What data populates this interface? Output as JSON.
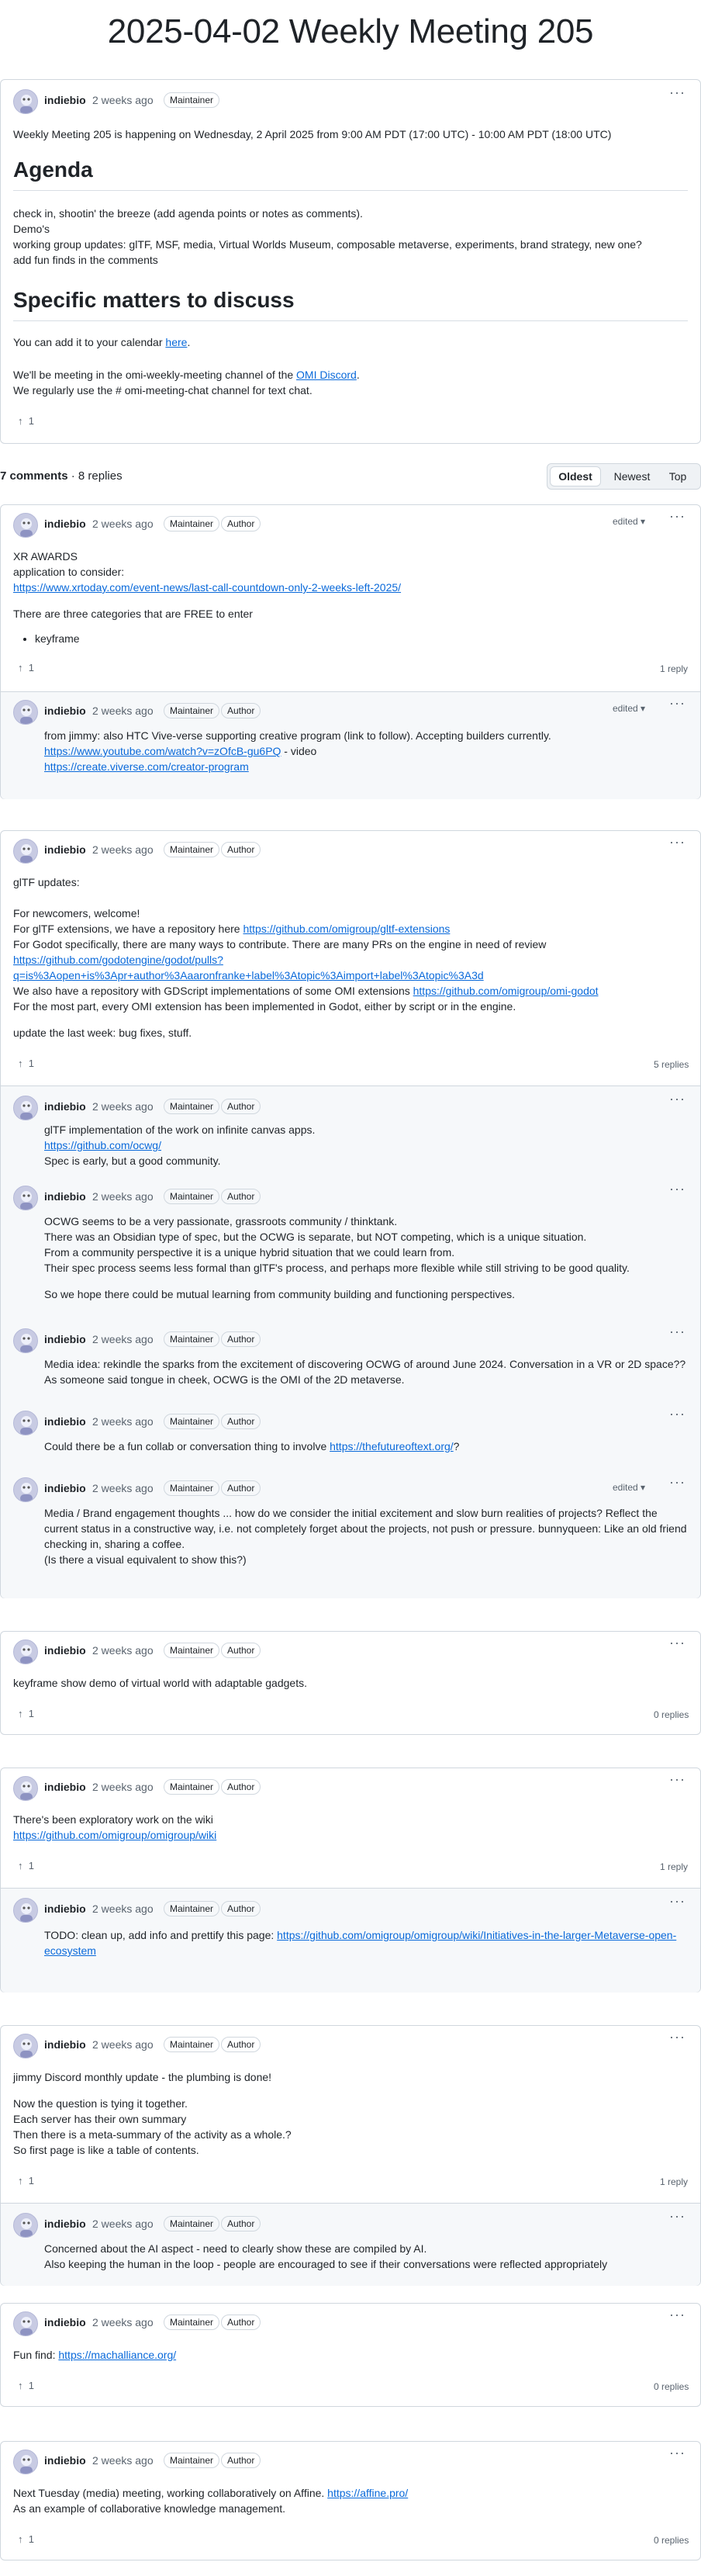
{
  "page_title": "2025-04-02 Weekly Meeting 205",
  "post": {
    "author": "indiebio",
    "time": "2 weeks ago",
    "badge": "Maintainer",
    "intro": "Weekly Meeting 205 is happening on Wednesday, 2 April 2025 from 9:00 AM PDT (17:00 UTC) - 10:00 AM PDT (18:00 UTC)",
    "agenda_heading": "Agenda",
    "agenda_lines": [
      "check in, shootin' the breeze (add agenda points or notes as comments).",
      "Demo's",
      "working group updates: glTF, MSF, media, Virtual Worlds Museum, composable metaverse, experiments, brand strategy, new one?",
      "add fun finds in the comments"
    ],
    "matters_heading": "Specific matters to discuss",
    "calendar_pre": "You can add it to your calendar ",
    "calendar_link": "here",
    "calendar_post": ".",
    "discord_pre": "We'll be meeting in the omi-weekly-meeting channel of the ",
    "discord_link": "OMI Discord",
    "discord_post": ".",
    "chat_line": "We regularly use the # omi-meeting-chat channel for text chat.",
    "upvotes": "1"
  },
  "comments_header": {
    "count": "7 comments",
    "sep": " · ",
    "replies": "8 replies"
  },
  "sort": {
    "oldest": "Oldest",
    "newest": "Newest",
    "top": "Top"
  },
  "labels": {
    "maintainer": "Maintainer",
    "author": "Author",
    "edited": "edited",
    "author_name": "indiebio",
    "time": "2 weeks ago"
  },
  "c1": {
    "l1": "XR AWARDS",
    "l2": "application to consider:",
    "link": "https://www.xrtoday.com/event-news/last-call-countdown-only-2-weeks-left-2025/",
    "l3": "There are three categories that are FREE to enter",
    "bullet": "keyframe",
    "upvotes": "1",
    "replies": "1 reply",
    "r1": {
      "l1": "from jimmy: also HTC Vive-verse supporting creative program (link to follow). Accepting builders currently.",
      "link1": "https://www.youtube.com/watch?v=zOfcB-gu6PQ",
      "l2": " - video",
      "link2": "https://create.viverse.com/creator-program"
    }
  },
  "c2": {
    "l1": "glTF updates:",
    "l2": "For newcomers, welcome!",
    "l3": "For glTF extensions, we have a repository here ",
    "link1": "https://github.com/omigroup/gltf-extensions",
    "l4": "For Godot specifically, there are many ways to contribute. There are many PRs on the engine in need of review",
    "link2a": "https://github.com/godotengine/godot/pulls?",
    "link2b": "q=is%3Aopen+is%3Apr+author%3Aaaronfranke+label%3Atopic%3Aimport+label%3Atopic%3A3d",
    "l5": "We also have a repository with GDScript implementations of some OMI extensions ",
    "link3": "https://github.com/omigroup/omi-godot",
    "l6": "For the most part, every OMI extension has been implemented in Godot, either by script or in the engine.",
    "l7": "update the last week: bug fixes, stuff.",
    "upvotes": "1",
    "replies": "5 replies",
    "r1": {
      "l1": "glTF implementation of the work on infinite canvas apps.",
      "link": "https://github.com/ocwg/",
      "l2": "Spec is early, but a good community."
    },
    "r2": {
      "l1": "OCWG seems to be a very passionate, grassroots community / thinktank.",
      "l2": "There was an Obsidian type of spec, but the OCWG is separate, but NOT competing, which is a unique situation.",
      "l3": "From a community perspective it is a unique hybrid situation that we could learn from.",
      "l4": "Their spec process seems less formal than glTF's process, and perhaps more flexible while still striving to be good quality.",
      "l5": "So we hope there could be mutual learning from community building and functioning perspectives."
    },
    "r3": {
      "l1": "Media idea: rekindle the sparks from the excitement of discovering OCWG of around June 2024. Conversation in a VR or 2D space??",
      "l2": "As someone said tongue in cheek, OCWG is the OMI of the 2D metaverse."
    },
    "r4": {
      "l1": "Could there be a fun collab or conversation thing to involve ",
      "link": "https://thefutureoftext.org/",
      "l2": "?"
    },
    "r5": {
      "l1": "Media / Brand engagement thoughts ... how do we consider the initial excitement and slow burn realities of projects? Reflect the",
      "l2": "current status in a constructive way, i.e. not completely forget about the projects, not push or pressure. bunnyqueen: Like an old friend",
      "l3": "checking in, sharing a coffee.",
      "l4": "(Is there a visual equivalent to show this?)"
    }
  },
  "c3": {
    "l1": "keyframe show demo of virtual world with adaptable gadgets.",
    "upvotes": "1",
    "replies": "0 replies"
  },
  "c4": {
    "l1": "There's been exploratory work on the wiki",
    "link": "https://github.com/omigroup/omigroup/wiki",
    "upvotes": "1",
    "replies": "1 reply",
    "r1": {
      "l1": "TODO: clean up, add info and prettify this page: ",
      "link_a": "https://github.com/omigroup/omigroup/wiki/Initiatives-in-the-larger-Metaverse-open-",
      "link_b": "ecosystem"
    }
  },
  "c5": {
    "l1": "jimmy Discord monthly update - the plumbing is done!",
    "l2": "Now the question is tying it together.",
    "l3": "Each server has their own summary",
    "l4": "Then there is a meta-summary of the activity as a whole.?",
    "l5": "So first page is like a table of contents.",
    "upvotes": "1",
    "replies": "1 reply",
    "r1": {
      "l1": "Concerned about the AI aspect - need to clearly show these are compiled by AI.",
      "l2": "Also keeping the human in the loop - people are encouraged to see if their conversations were reflected appropriately"
    }
  },
  "c6": {
    "l1": "Fun find: ",
    "link": "https://machalliance.org/",
    "upvotes": "1",
    "replies": "0 replies"
  },
  "c7": {
    "l1": "Next Tuesday (media) meeting, working collaboratively on Affine. ",
    "link": "https://affine.pro/",
    "l2": "As an example of collaborative knowledge management.",
    "upvotes": "1",
    "replies": "0 replies"
  },
  "colors": {
    "link": "#0969da",
    "border": "#d0d7de",
    "muted": "#59636e",
    "reply_bg": "#f6f8fa"
  },
  "icons": {
    "upvote": "arrow-up-icon",
    "more": "kebab-icon",
    "avatar": "octocat-avatar",
    "dropdown": "triangle-down-icon"
  }
}
